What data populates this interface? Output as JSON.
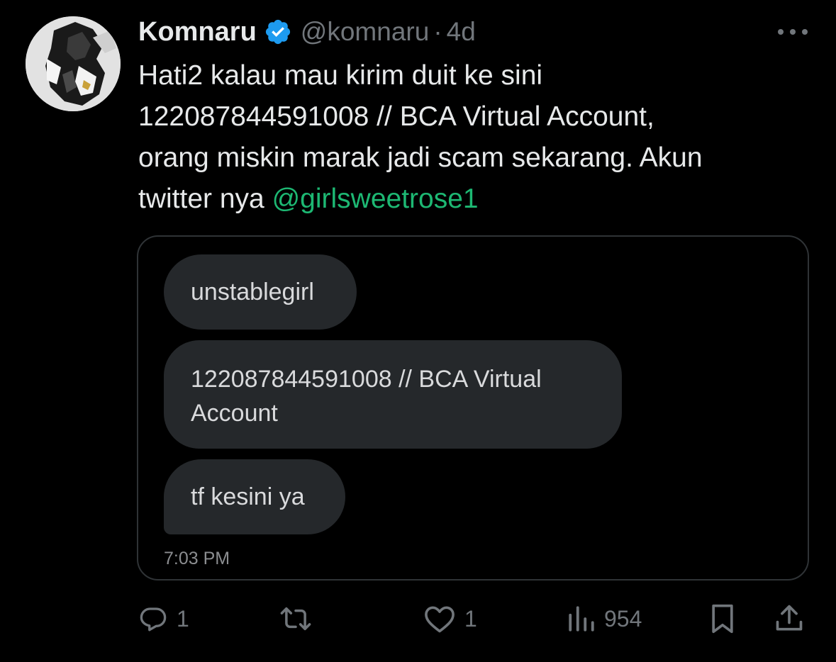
{
  "tweet": {
    "author": {
      "display_name": "Komnaru",
      "handle": "@komnaru",
      "verified_icon": "verified-badge-icon",
      "verified_color": "#1d9bf0"
    },
    "separator": "·",
    "time_ago": "4d",
    "text_main": "Hati2 kalau mau kirim duit ke sini\n122087844591008 // BCA Virtual Account,\norang miskin marak jadi scam sekarang. Akun\ntwitter nya ",
    "mention": "@girlsweetrose1",
    "mention_color": "#1db873"
  },
  "media": {
    "messages": [
      {
        "text": "unstablegirl"
      },
      {
        "text": "122087844591008 // BCA Virtual Account"
      },
      {
        "text": "tf kesini ya"
      }
    ],
    "timestamp": "7:03 PM"
  },
  "actions": {
    "reply_count": "1",
    "repost_count": "",
    "like_count": "1",
    "views_count": "954"
  },
  "colors": {
    "background": "#000000",
    "text": "#e7e9ea",
    "secondary": "#71767b",
    "bubble": "#25282b"
  }
}
